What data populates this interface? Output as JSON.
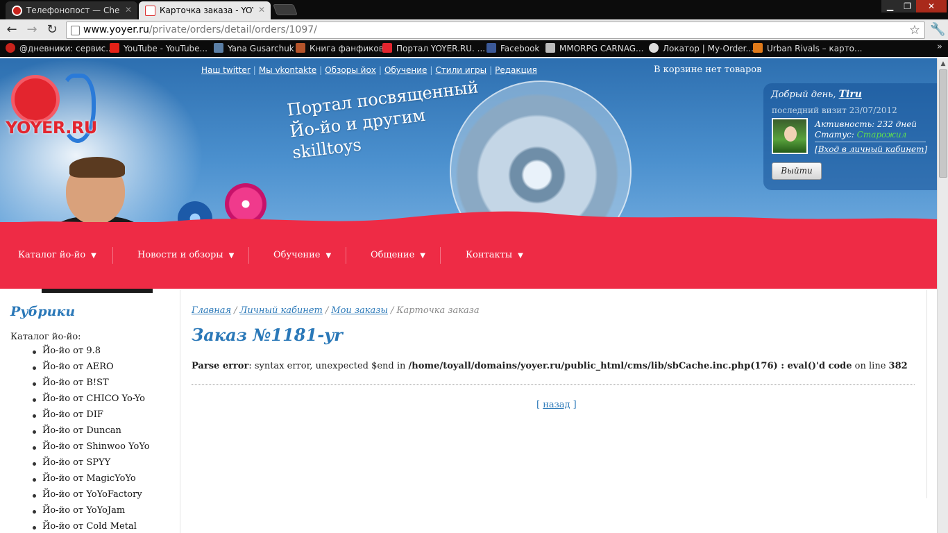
{
  "browser": {
    "tabs": [
      {
        "label": "Телефонопост — Check M",
        "active": false
      },
      {
        "label": "Карточка заказа - YOYER.R",
        "active": true
      }
    ],
    "url": {
      "host": "www.yoyer.ru",
      "path": "/private/orders/detail/orders/1097/"
    },
    "bookmarks": [
      {
        "label": "@дневники: сервис...",
        "icon": "diary-icon",
        "color": "#c8231c"
      },
      {
        "label": "YouTube - YouTube...",
        "icon": "youtube-icon",
        "color": "#e62117"
      },
      {
        "label": "Yana Gusarchuk",
        "icon": "vk-icon",
        "color": "#5b7fa6"
      },
      {
        "label": "Книга фанфиков",
        "icon": "quill-icon",
        "color": "#b5542b"
      },
      {
        "label": "Портал YOYER.RU. ...",
        "icon": "yoyer-icon",
        "color": "#e3252e"
      },
      {
        "label": "Facebook",
        "icon": "facebook-icon",
        "color": "#3b5998"
      },
      {
        "label": "MMORPG CARNAG...",
        "icon": "shield-icon",
        "color": "#bbbbbb"
      },
      {
        "label": "Локатор | My-Order...",
        "icon": "eye-icon",
        "color": "#dddddd"
      },
      {
        "label": "Urban Rivals – карто...",
        "icon": "urban-icon",
        "color": "#e07a1a"
      }
    ]
  },
  "header": {
    "logo_text": "YOYER.RU",
    "slogan": "Портал посвященный Йо-йо и другим skilltoys",
    "top_links": [
      "Наш twitter",
      "Мы vkontakte",
      "Обзоры йох",
      "Обучение",
      "Стили игры",
      "Редакция"
    ],
    "cart_message": "В корзине нет товаров"
  },
  "user": {
    "greeting": "Добрый день,",
    "name": "Tiru",
    "last_visit": "последний визит 23/07/2012",
    "activity": "Активность: 232 дней",
    "status_label": "Статус:",
    "status_value": "Старожил",
    "cabinet_link": "Вход в личный кабинет",
    "logout_label": "Выйти"
  },
  "main_nav": [
    "Каталог йо-йо",
    "Новости и обзоры",
    "Обучение",
    "Общение",
    "Контакты"
  ],
  "sidebar": {
    "title": "Рубрики",
    "catalog_label": "Каталог йо-йо:",
    "items": [
      "Йо-йо от 9.8",
      "Йо-йо от AERO",
      "Йо-йо от B!ST",
      "Йо-йо от CHICO Yo-Yo",
      "Йо-йо от DIF",
      "Йо-йо от Duncan",
      "Йо-йо от Shinwoo YoYo",
      "Йо-йо от SPYY",
      "Йо-йо от MagicYoYo",
      "Йо-йо от YoYoFactory",
      "Йо-йо от YoYoJam",
      "Йо-йо от Cold Metal"
    ]
  },
  "content": {
    "breadcrumb": [
      "Главная",
      "Личный кабинет",
      "Мои заказы",
      "Карточка заказа"
    ],
    "order_title": "Заказ №1181-yr",
    "error": {
      "label": "Parse error",
      "message": ": syntax error, unexpected $end in ",
      "path": "/home/toyall/domains/yoyer.ru/public_html/cms/lib/sbCache.inc.php(176) : eval()'d code",
      "on_line": " on line ",
      "line": "382"
    },
    "back_link": "назад"
  },
  "colors": {
    "accent_blue": "#2a78b8",
    "nav_red": "#ee2b45",
    "status_green": "#5fe04e"
  }
}
